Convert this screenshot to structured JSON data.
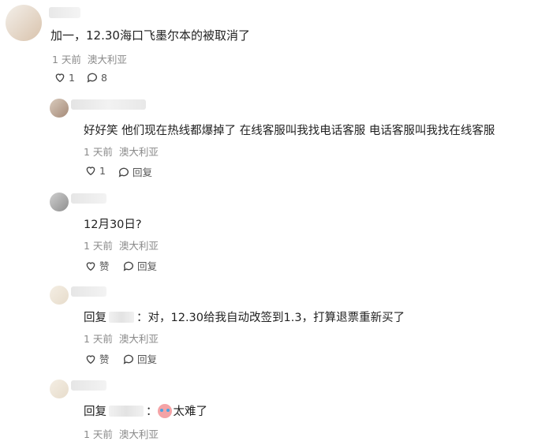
{
  "main_comment": {
    "text": "加一，12.30海口飞墨尔本的被取消了",
    "time": "1 天前",
    "location": "澳大利亚",
    "like_count": "1",
    "reply_count": "8"
  },
  "replies": [
    {
      "text": "好好笑 他们现在热线都爆掉了 在线客服叫我找电话客服 电话客服叫我找在线客服",
      "time": "1 天前",
      "location": "澳大利亚",
      "like_label": "1",
      "reply_label": "回复"
    },
    {
      "text": "12月30日?",
      "time": "1 天前",
      "location": "澳大利亚",
      "like_label": "赞",
      "reply_label": "回复"
    },
    {
      "reply_prefix": "回复",
      "text": "：对，12.30给我自动改签到1.3，打算退票重新买了",
      "time": "1 天前",
      "location": "澳大利亚",
      "like_label": "赞",
      "reply_label": "回复"
    },
    {
      "reply_prefix": "回复",
      "text": "太难了",
      "time": "1 天前",
      "location": "澳大利亚"
    }
  ],
  "icons": {
    "like": "heart-outline-icon",
    "comment": "speech-bubble-icon",
    "emoji": "crying-face-emoji"
  }
}
